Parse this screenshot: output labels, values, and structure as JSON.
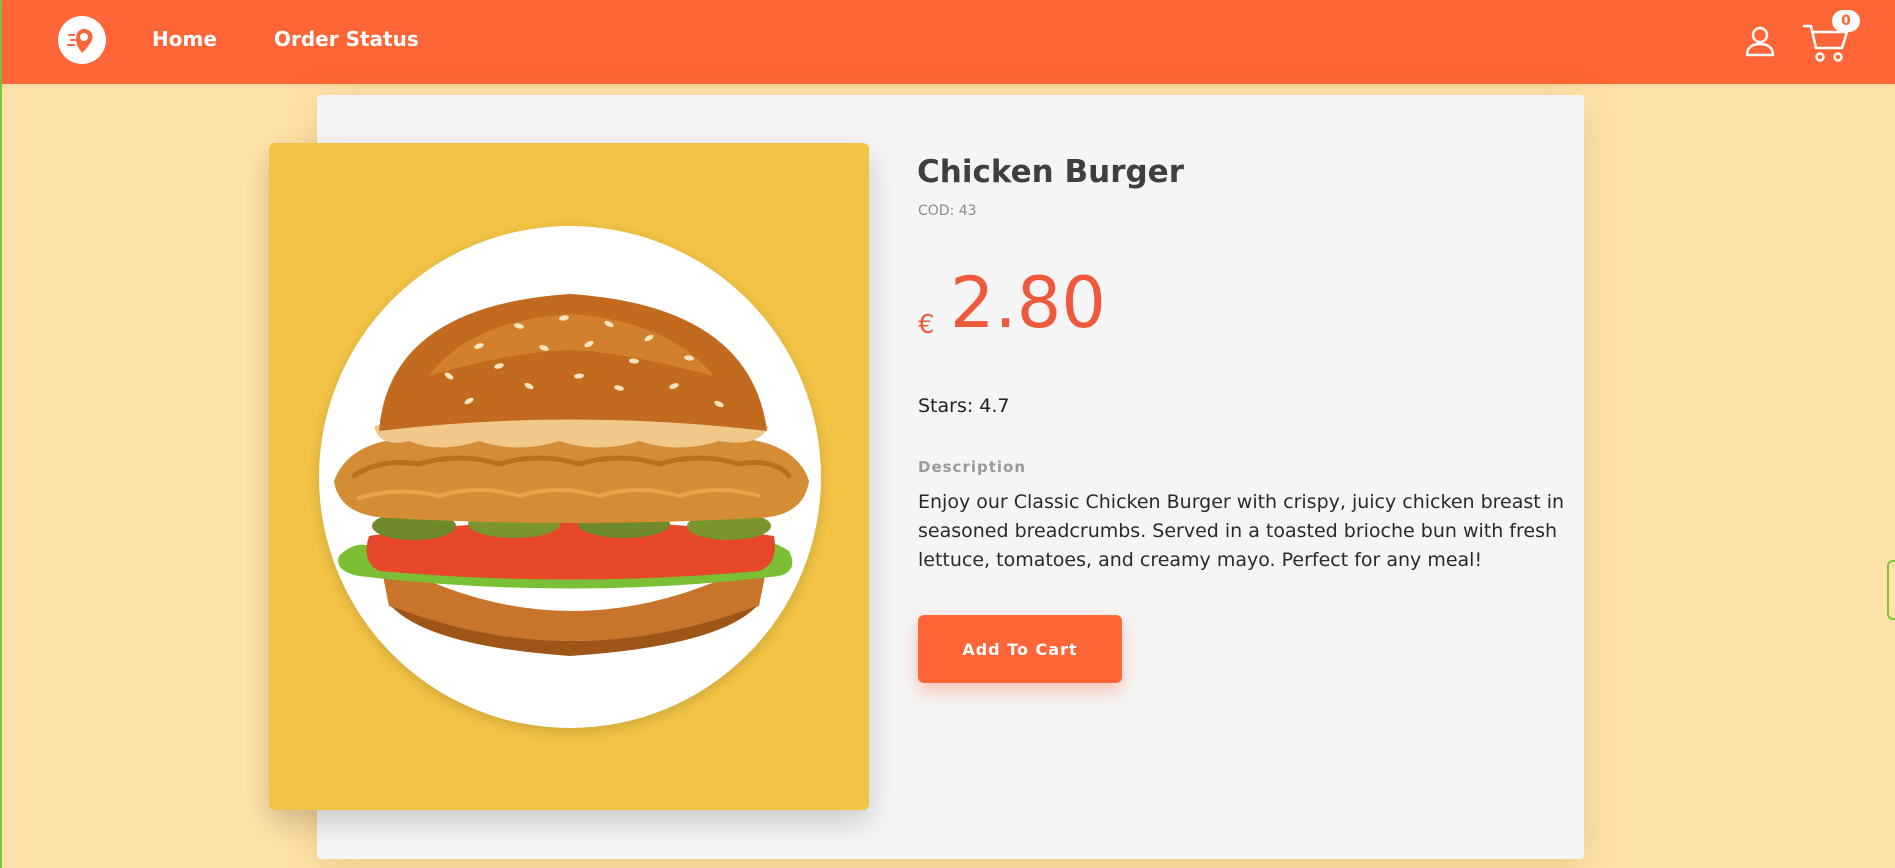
{
  "nav": {
    "home_label": "Home",
    "order_status_label": "Order Status",
    "cart_count": "0"
  },
  "product": {
    "title": "Chicken Burger",
    "code": "COD: 43",
    "currency": "€",
    "price": "2.80",
    "stars": "Stars: 4.7",
    "description_label": "Description",
    "description": "Enjoy our Classic Chicken Burger with crispy, juicy chicken breast in seasoned breadcrumbs. Served in a toasted brioche bun with fresh lettuce, tomatoes, and creamy mayo. Perfect for any meal!",
    "add_to_cart_label": "Add To Cart",
    "image_icon": "chicken-burger-image"
  },
  "colors": {
    "brand": "#ff6536",
    "page_background": "#ffe2a9",
    "image_panel": "#f2c344",
    "price": "#ef5a3c"
  }
}
